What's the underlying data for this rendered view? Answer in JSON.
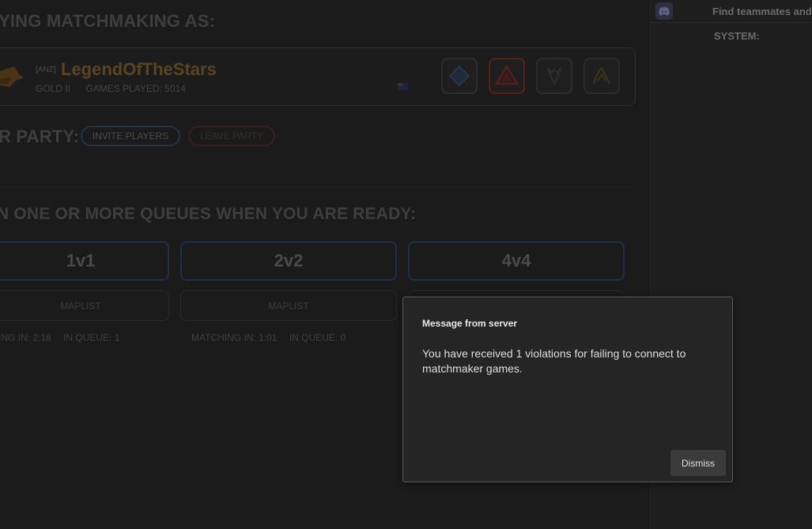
{
  "main": {
    "heading_playing_as": "YING MATCHMAKING AS:",
    "player": {
      "region_tag": "[ANZ]",
      "name": "LegendOfTheStars",
      "rank": "GOLD II",
      "games_played": "GAMES PLAYED: 5014"
    },
    "factions": [
      {
        "name": "faction-1-icon",
        "selected": false
      },
      {
        "name": "faction-2-icon",
        "selected": true
      },
      {
        "name": "faction-3-icon",
        "selected": false
      },
      {
        "name": "faction-4-icon",
        "selected": false
      }
    ],
    "party": {
      "heading": "R PARTY:",
      "invite_label": "INVITE PLAYERS",
      "leave_label": "LEAVE PARTY"
    },
    "queues_heading": "N ONE OR MORE QUEUES WHEN YOU ARE READY:",
    "queues": [
      {
        "label": "1v1",
        "maplist": "MAPLIST",
        "matching": "ING IN: 2:18",
        "in_queue": "IN QUEUE: 1"
      },
      {
        "label": "2v2",
        "maplist": "MAPLIST",
        "matching": "MATCHING IN: 1:01",
        "in_queue": "IN QUEUE: 0"
      },
      {
        "label": "4v4",
        "maplist": "",
        "matching": "",
        "in_queue": ""
      }
    ]
  },
  "right_panel": {
    "find_text": "Find teammates and",
    "system_label": "SYSTEM:"
  },
  "modal": {
    "title": "Message from server",
    "body": "You have received 1 violations for failing to connect to matchmaker games.",
    "dismiss_label": "Dismiss"
  },
  "colors": {
    "accent_name": "#5a4322",
    "queue_border": "#1f2e44",
    "leave_border": "#3a1e1e"
  }
}
